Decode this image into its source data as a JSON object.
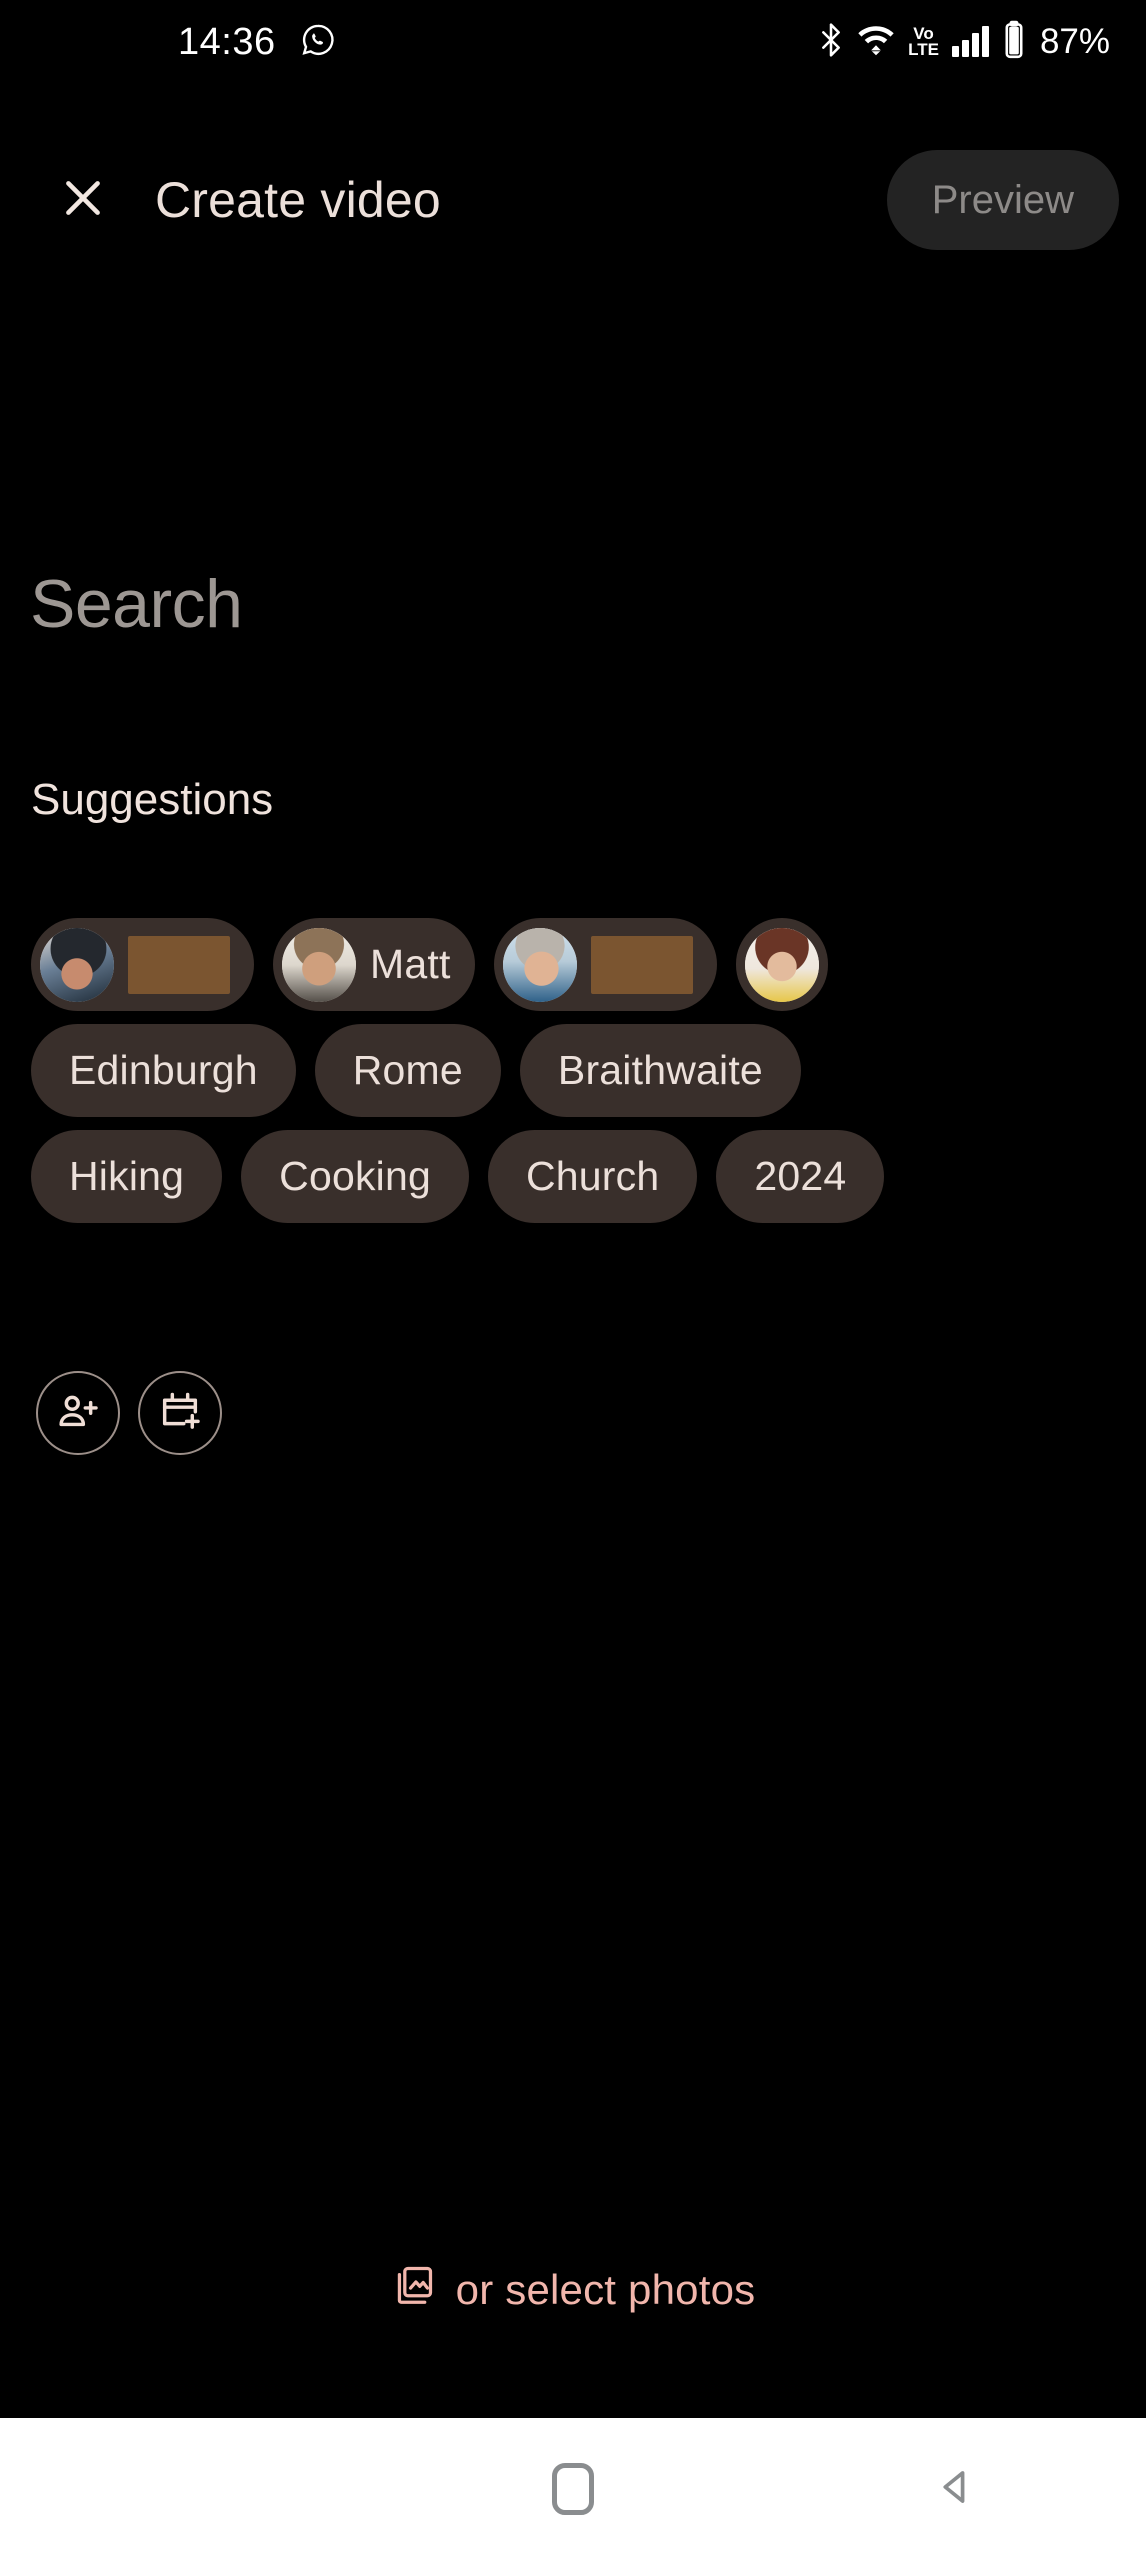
{
  "status_bar": {
    "time": "14:36",
    "left_icons": [
      "whatsapp-icon"
    ],
    "right_icons": [
      "bluetooth-icon",
      "wifi-icon",
      "volte-icon",
      "signal-bars-icon",
      "battery-icon"
    ],
    "volte_top": "Vo",
    "volte_bottom": "LTE",
    "battery_percent": "87%"
  },
  "app_bar": {
    "close_label": "close-icon",
    "title": "Create video",
    "preview_label": "Preview"
  },
  "search": {
    "placeholder": "Search",
    "value": ""
  },
  "suggestions": {
    "title": "Suggestions",
    "rows": [
      {
        "chips": [
          {
            "type": "face",
            "label": "",
            "redacted": true,
            "redacted_width": 102,
            "avatar": "av-a"
          },
          {
            "type": "face",
            "label": "Matt",
            "redacted": false,
            "avatar": "av-b"
          },
          {
            "type": "face",
            "label": "",
            "redacted": true,
            "redacted_width": 102,
            "avatar": "av-c"
          },
          {
            "type": "face-only",
            "label": "",
            "redacted": false,
            "avatar": "av-d"
          }
        ]
      },
      {
        "chips": [
          {
            "type": "text",
            "label": "Edinburgh"
          },
          {
            "type": "text",
            "label": "Rome"
          },
          {
            "type": "text",
            "label": "Braithwaite"
          }
        ]
      },
      {
        "chips": [
          {
            "type": "text",
            "label": "Hiking"
          },
          {
            "type": "text",
            "label": "Cooking"
          },
          {
            "type": "text",
            "label": "Church"
          },
          {
            "type": "text",
            "label": "2024"
          }
        ]
      }
    ]
  },
  "actions": [
    {
      "name": "add-person-button",
      "icon": "person-add-icon"
    },
    {
      "name": "add-date-button",
      "icon": "calendar-add-icon"
    }
  ],
  "footer": {
    "select_photos_label": "or select photos",
    "select_photos_icon": "photo-library-icon"
  },
  "nav_bar": {
    "recents": "recents-icon",
    "home": "home-icon",
    "back": "back-icon"
  },
  "colors": {
    "background": "#000000",
    "chip_background": "#392f2b",
    "chip_text": "#ece0da",
    "accent": "#f1b6ac",
    "redaction": "#7b5530",
    "preview_button_bg": "#232323",
    "preview_button_text": "#8d8a88",
    "nav_bar_bg": "#ffffff"
  }
}
